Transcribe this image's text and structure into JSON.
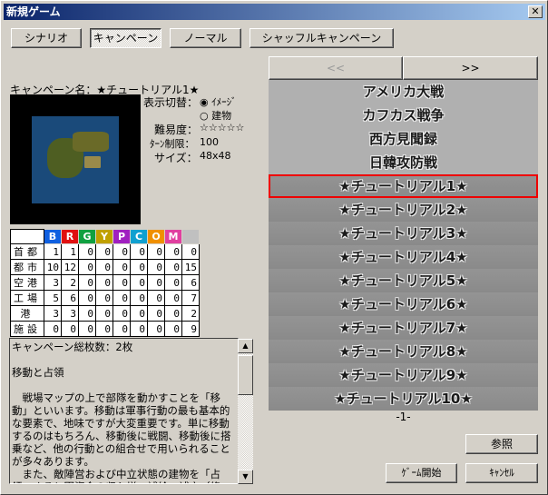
{
  "window": {
    "title": "新規ゲーム",
    "close": "✕"
  },
  "modes": [
    "シナリオ",
    "キャンペーン",
    "ノーマル",
    "シャッフルキャンペーン"
  ],
  "nav": {
    "prev": "<<",
    "next": ">>"
  },
  "campaign": {
    "name_label": "キャンペーン名：★チュートリアル1★",
    "display_label": "表示切替：",
    "display_options": [
      "ｲﾒｰｼﾞ",
      "建物"
    ],
    "display_selected": "ｲﾒｰｼﾞ",
    "difficulty_label": "難易度：",
    "difficulty": "☆☆☆☆☆",
    "turn_label": "ﾀｰﾝ制限：",
    "turn": "100",
    "size_label": "サイズ：",
    "size": "48x48"
  },
  "table": {
    "headers": [
      "B",
      "R",
      "G",
      "Y",
      "P",
      "C",
      "O",
      "M",
      ""
    ],
    "header_colors": [
      "#1060e0",
      "#e01010",
      "#10a040",
      "#c0a000",
      "#a020c0",
      "#10a0d0",
      "#f09000",
      "#e040a0",
      "#c0c0c0"
    ],
    "rows": [
      {
        "label": "首都",
        "values": [
          "1",
          "1",
          "0",
          "0",
          "0",
          "0",
          "0",
          "0",
          "0"
        ]
      },
      {
        "label": "都市",
        "values": [
          "10",
          "12",
          "0",
          "0",
          "0",
          "0",
          "0",
          "0",
          "15"
        ]
      },
      {
        "label": "空港",
        "values": [
          "3",
          "2",
          "0",
          "0",
          "0",
          "0",
          "0",
          "0",
          "6"
        ]
      },
      {
        "label": "工場",
        "values": [
          "5",
          "6",
          "0",
          "0",
          "0",
          "0",
          "0",
          "0",
          "7"
        ]
      },
      {
        "label": "港",
        "values": [
          "3",
          "3",
          "0",
          "0",
          "0",
          "0",
          "0",
          "0",
          "2"
        ]
      },
      {
        "label": "施設",
        "values": [
          "0",
          "0",
          "0",
          "0",
          "0",
          "0",
          "0",
          "0",
          "9"
        ]
      }
    ]
  },
  "description": "キャンペーン総枚数：2枚\n\n移動と占領\n\n　戦場マップの上で部隊を動かすことを「移動」といいます。移動は軍事行動の最も基本的な要素で、地味ですが大変重要です。単に移動するのはもちろん、移動後に戦闘、移動後に搭乗など、他の行動との組合せで用いられることが多々あります。\n　また、敵陣営および中立状態の建物を「占領」すると軍資金の収入増、補給・補充（修理）拠点の確保、索敵範囲の拡大などの恩恵",
  "list": [
    "アメリカ大戦",
    "カフカス戦争",
    "西方見聞録",
    "日韓攻防戦",
    "★チュートリアル1★",
    "★チュートリアル2★",
    "★チュートリアル3★",
    "★チュートリアル4★",
    "★チュートリアル5★",
    "★チュートリアル6★",
    "★チュートリアル7★",
    "★チュートリアル8★",
    "★チュートリアル9★",
    "★チュートリアル10★"
  ],
  "page": "-1-",
  "buttons": {
    "browse": "参照",
    "start": "ｹﾞｰﾑ開始",
    "cancel": "ｷｬﾝｾﾙ"
  }
}
